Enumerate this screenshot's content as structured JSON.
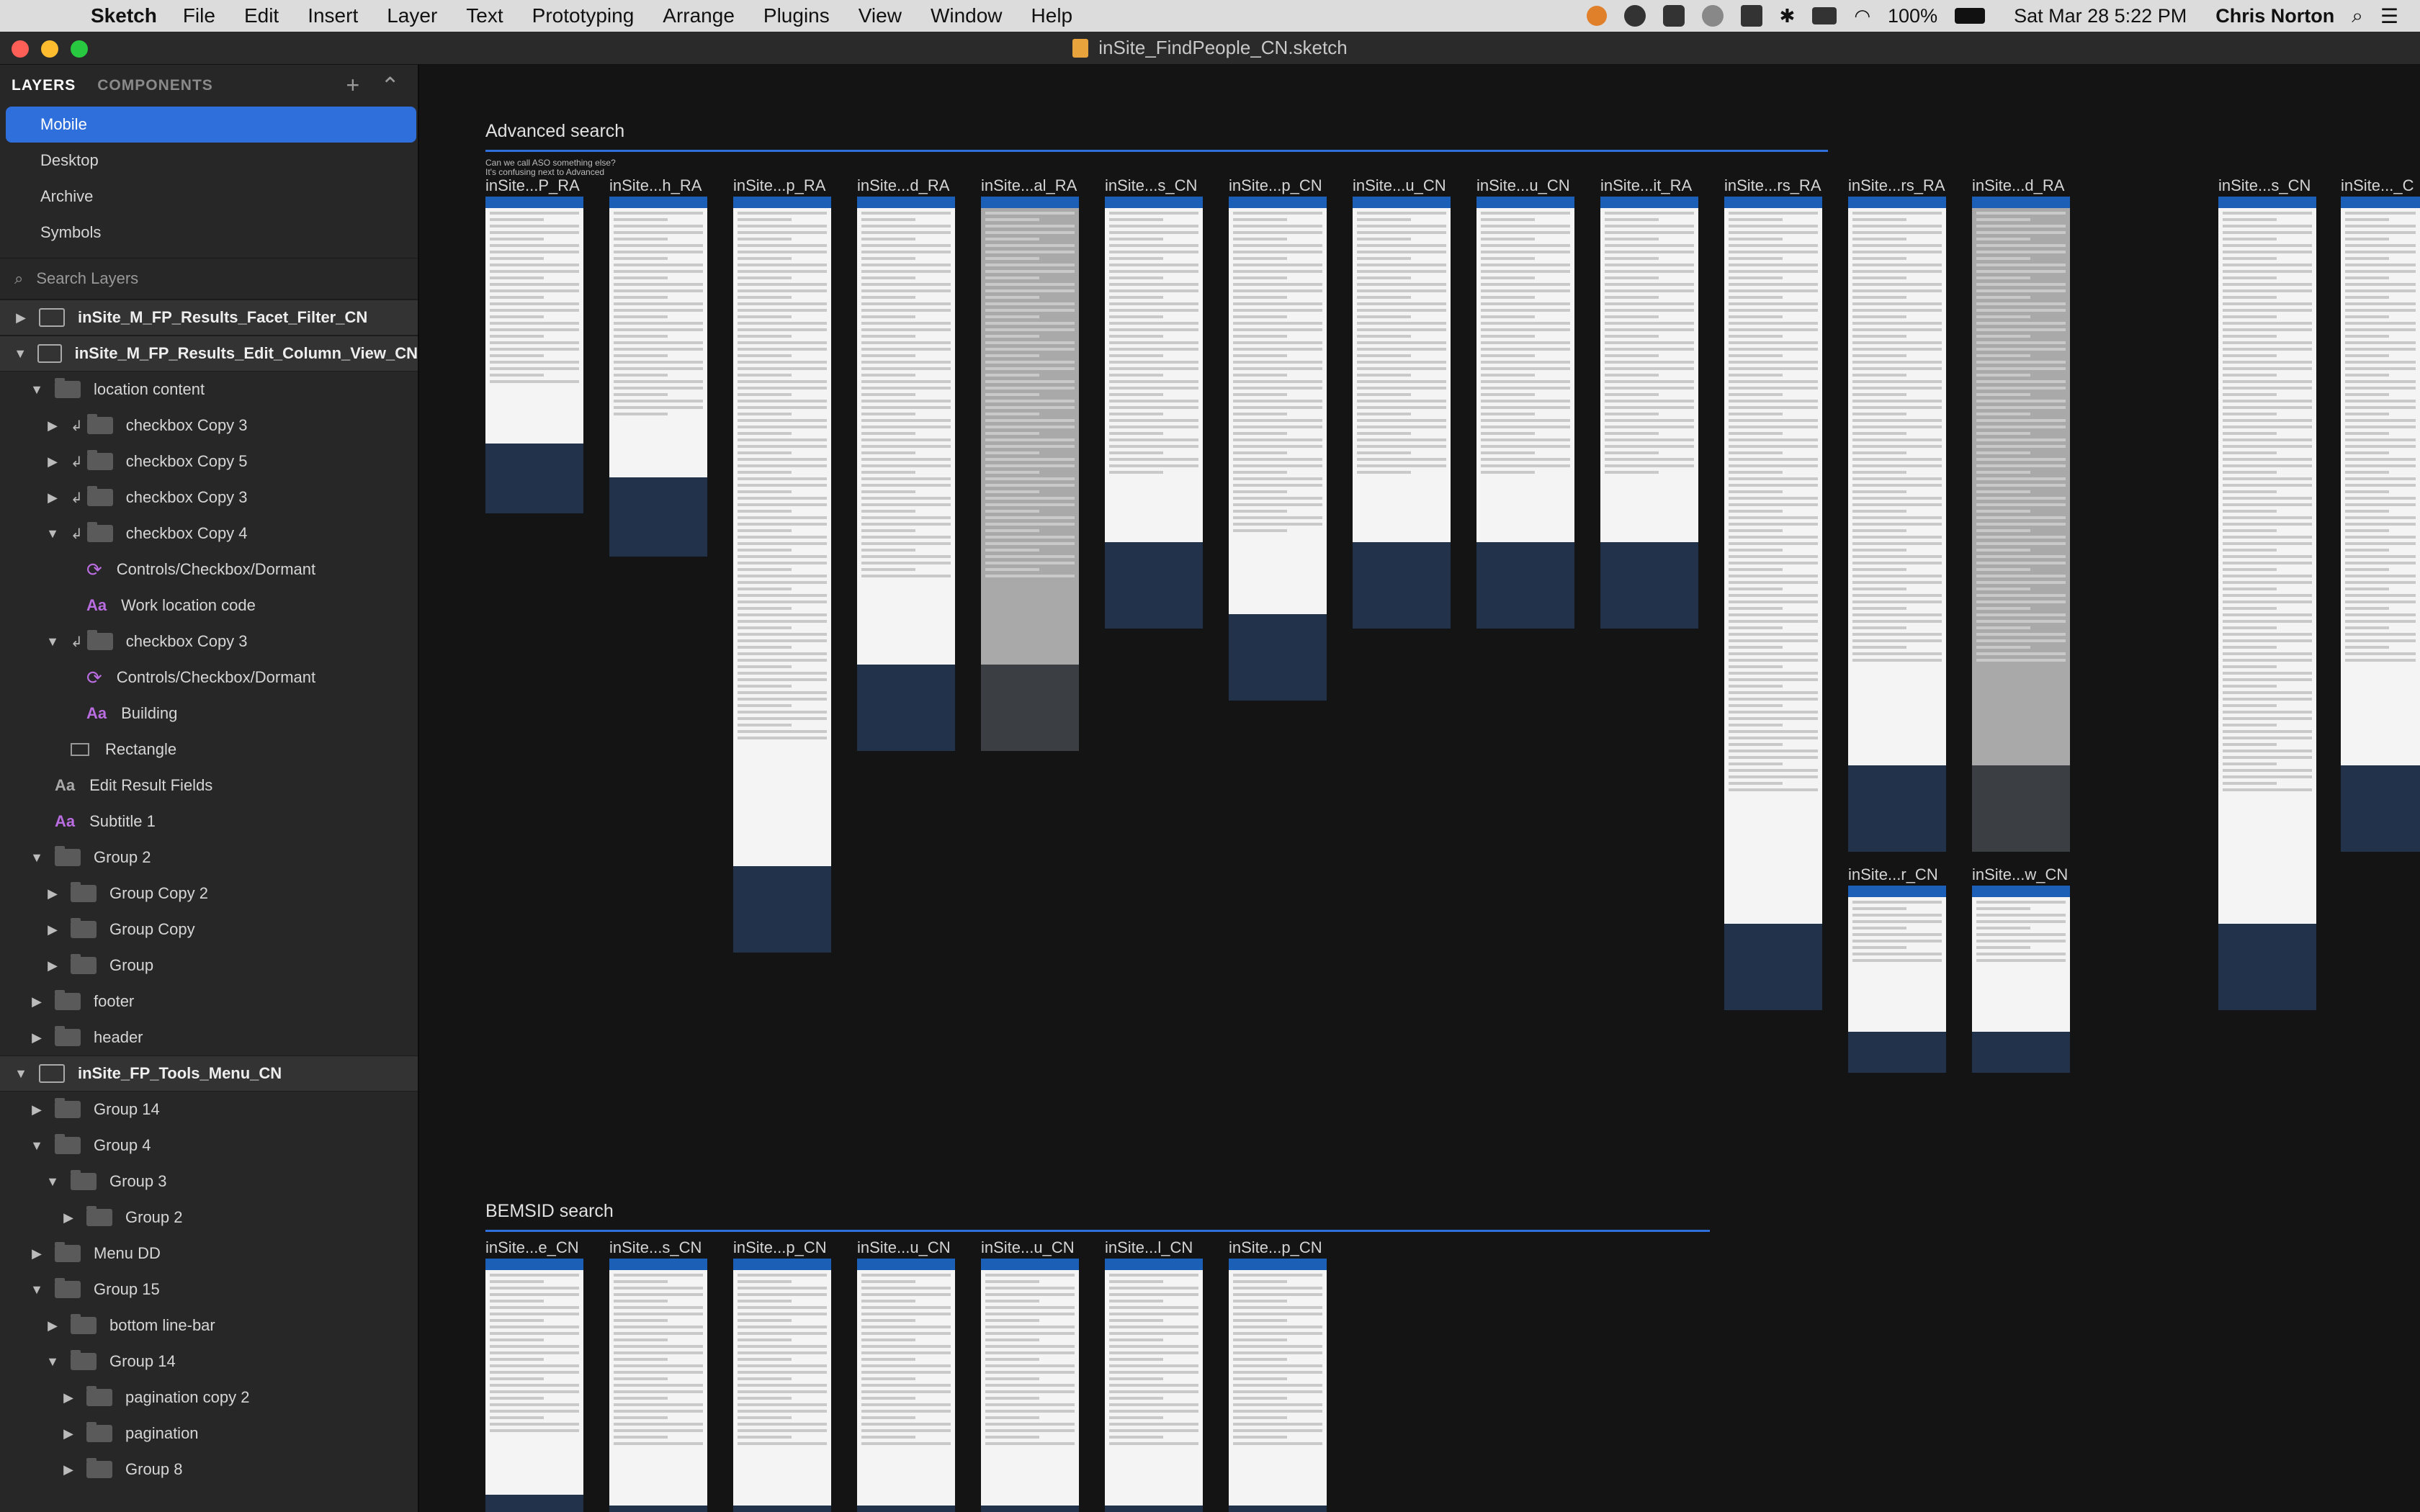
{
  "menubar": {
    "app": "Sketch",
    "items": [
      "File",
      "Edit",
      "Insert",
      "Layer",
      "Text",
      "Prototyping",
      "Arrange",
      "Plugins",
      "View",
      "Window",
      "Help"
    ],
    "battery": "100%",
    "datetime": "Sat Mar 28  5:22 PM",
    "user": "Chris Norton"
  },
  "window": {
    "title": "inSite_FindPeople_CN.sketch"
  },
  "sidebar": {
    "tabs": [
      "LAYERS",
      "COMPONENTS"
    ],
    "pages": [
      "Mobile",
      "Desktop",
      "Archive",
      "Symbols"
    ],
    "search_placeholder": "Search Layers",
    "layers": [
      {
        "label": "inSite_M_FP_Results_Facet_Filter_CN",
        "kind": "artboard",
        "indent": 0,
        "expanded": false
      },
      {
        "label": "inSite_M_FP_Results_Edit_Column_View_CN",
        "kind": "artboard",
        "indent": 0,
        "expanded": true
      },
      {
        "label": "location content",
        "kind": "group",
        "indent": 1,
        "expanded": true
      },
      {
        "label": "checkbox Copy 3",
        "kind": "group",
        "indent": 2,
        "expanded": false,
        "mask": true
      },
      {
        "label": "checkbox Copy 5",
        "kind": "group",
        "indent": 2,
        "expanded": false,
        "mask": true
      },
      {
        "label": "checkbox Copy 3",
        "kind": "group",
        "indent": 2,
        "expanded": false,
        "mask": true
      },
      {
        "label": "checkbox Copy 4",
        "kind": "group",
        "indent": 2,
        "expanded": true,
        "mask": true
      },
      {
        "label": "Controls/Checkbox/Dormant",
        "kind": "symbol",
        "indent": 3
      },
      {
        "label": "Work location code",
        "kind": "text",
        "indent": 3
      },
      {
        "label": "checkbox Copy 3",
        "kind": "group",
        "indent": 2,
        "expanded": true,
        "mask": true
      },
      {
        "label": "Controls/Checkbox/Dormant",
        "kind": "symbol",
        "indent": 3
      },
      {
        "label": "Building",
        "kind": "text",
        "indent": 3
      },
      {
        "label": "Rectangle",
        "kind": "rect",
        "indent": 2
      },
      {
        "label": "Edit Result Fields",
        "kind": "textg",
        "indent": 1
      },
      {
        "label": "Subtitle 1",
        "kind": "text",
        "indent": 1
      },
      {
        "label": "Group 2",
        "kind": "group",
        "indent": 1,
        "expanded": true
      },
      {
        "label": "Group Copy 2",
        "kind": "group",
        "indent": 2,
        "expanded": false
      },
      {
        "label": "Group Copy",
        "kind": "group",
        "indent": 2,
        "expanded": false
      },
      {
        "label": "Group",
        "kind": "group",
        "indent": 2,
        "expanded": false
      },
      {
        "label": "footer",
        "kind": "group",
        "indent": 1,
        "expanded": false
      },
      {
        "label": "header",
        "kind": "group",
        "indent": 1,
        "expanded": false
      },
      {
        "label": "inSite_FP_Tools_Menu_CN",
        "kind": "artboard",
        "indent": 0,
        "expanded": true
      },
      {
        "label": "Group 14",
        "kind": "group",
        "indent": 1,
        "expanded": false
      },
      {
        "label": "Group 4",
        "kind": "group",
        "indent": 1,
        "expanded": true
      },
      {
        "label": "Group 3",
        "kind": "group",
        "indent": 2,
        "expanded": true
      },
      {
        "label": "Group 2",
        "kind": "group",
        "indent": 3,
        "expanded": false
      },
      {
        "label": "Menu DD",
        "kind": "group",
        "indent": 1,
        "expanded": false
      },
      {
        "label": "Group 15",
        "kind": "group",
        "indent": 1,
        "expanded": true
      },
      {
        "label": "bottom line-bar",
        "kind": "group",
        "indent": 2,
        "expanded": false
      },
      {
        "label": "Group 14",
        "kind": "group",
        "indent": 2,
        "expanded": true
      },
      {
        "label": "pagination copy 2",
        "kind": "group",
        "indent": 3,
        "expanded": false
      },
      {
        "label": "pagination",
        "kind": "group",
        "indent": 3,
        "expanded": false
      },
      {
        "label": "Group 8",
        "kind": "group",
        "indent": 3,
        "expanded": false
      }
    ]
  },
  "canvas": {
    "sections": [
      {
        "title": "Advanced search",
        "note": "Can we call ASO something else?\nIt's confusing next to Advanced"
      },
      {
        "title": "BEMSID search"
      }
    ],
    "advanced_artboards": [
      "inSite...P_RA",
      "inSite...h_RA",
      "inSite...p_RA",
      "inSite...d_RA",
      "inSite...al_RA",
      "inSite...s_CN",
      "inSite...p_CN",
      "inSite...u_CN",
      "inSite...u_CN",
      "inSite...it_RA",
      "inSite...rs_RA",
      "inSite...rs_RA",
      "inSite...d_RA",
      "inSite...s_CN",
      "inSite..._C",
      "inSite...r_CN",
      "inSite...w_CN"
    ],
    "bemsid_artboards": [
      "inSite...e_CN",
      "inSite...s_CN",
      "inSite...p_CN",
      "inSite...u_CN",
      "inSite...u_CN",
      "inSite...l_CN",
      "inSite...p_CN"
    ]
  }
}
